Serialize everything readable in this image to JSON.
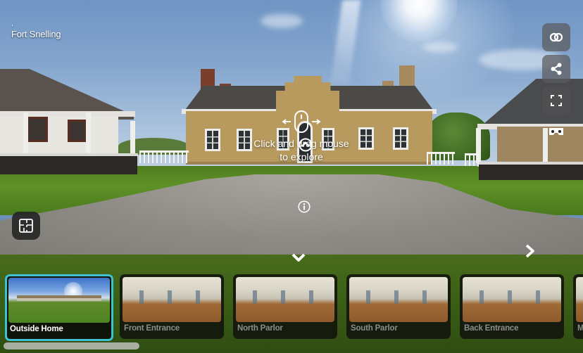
{
  "tour": {
    "subtitle_marker": ".",
    "title": "Fort Snelling"
  },
  "controls": [
    {
      "name": "toggle-view-button",
      "icon": "toggle-rings-icon",
      "label": "Toggle view"
    },
    {
      "name": "share-button",
      "icon": "share-icon",
      "label": "Share"
    },
    {
      "name": "fullscreen-button",
      "icon": "fullscreen-icon",
      "label": "Fullscreen"
    },
    {
      "name": "vr-button",
      "icon": "vr-headset-icon",
      "label": "VR mode"
    }
  ],
  "hint": {
    "icon": "mouse-drag-icon",
    "text_line1": "Click and drag mouse",
    "text_line2": "to explore"
  },
  "buttons": {
    "floorplan_icon": "floorplan-icon",
    "info_icon": "info-icon",
    "collapse_icon": "chevron-down-icon",
    "next_icon": "chevron-right-icon"
  },
  "scenes": [
    {
      "label": "Outside Home",
      "active": true,
      "kind": "outdoor"
    },
    {
      "label": "Front Entrance",
      "active": false,
      "kind": "indoor"
    },
    {
      "label": "North Parlor",
      "active": false,
      "kind": "indoor"
    },
    {
      "label": "South Parlor",
      "active": false,
      "kind": "indoor"
    },
    {
      "label": "Back Entrance",
      "active": false,
      "kind": "indoor"
    },
    {
      "label": "M",
      "active": false,
      "kind": "indoor"
    }
  ],
  "colors": {
    "active_accent": "#3ec1d0",
    "control_bg": "#5a5a5c",
    "inactive_label": "#8d8d8a"
  }
}
